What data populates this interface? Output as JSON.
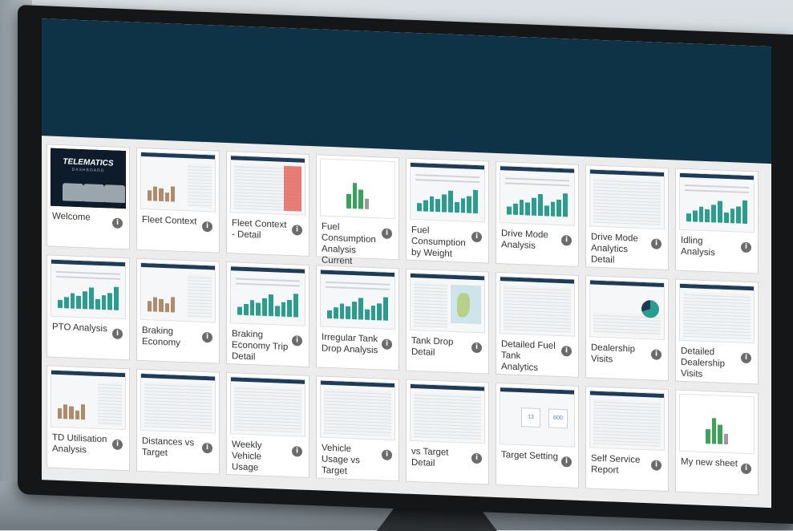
{
  "sheets": [
    {
      "title": "Welcome",
      "thumb": "logo"
    },
    {
      "title": "Fleet Context",
      "thumb": "dashboard"
    },
    {
      "title": "Fleet Context - Detail",
      "thumb": "table-red"
    },
    {
      "title": "Fuel Consumption Analysis Current",
      "thumb": "placeholder"
    },
    {
      "title": "Fuel Consumption by Weight",
      "thumb": "bars"
    },
    {
      "title": "Drive Mode Analysis",
      "thumb": "bars"
    },
    {
      "title": "Drive Mode Analytics Detail",
      "thumb": "table"
    },
    {
      "title": "Idling Analysis",
      "thumb": "bars"
    },
    {
      "title": "PTO Analysis",
      "thumb": "bars"
    },
    {
      "title": "Braking Economy",
      "thumb": "dashboard"
    },
    {
      "title": "Braking Economy Trip Detail",
      "thumb": "bars"
    },
    {
      "title": "Irregular Tank Drop Analysis",
      "thumb": "bars"
    },
    {
      "title": "Tank Drop Detail",
      "thumb": "map"
    },
    {
      "title": "Detailed Fuel Tank Analytics",
      "thumb": "table"
    },
    {
      "title": "Dealership Visits",
      "thumb": "pie"
    },
    {
      "title": "Detailed Dealership Visits",
      "thumb": "table"
    },
    {
      "title": "TD Utilisation Analysis",
      "thumb": "dashboard"
    },
    {
      "title": "Distances vs Target",
      "thumb": "table"
    },
    {
      "title": "Weekly Vehicle Usage",
      "thumb": "table"
    },
    {
      "title": "Vehicle Usage vs Target",
      "thumb": "table"
    },
    {
      "title": "vs Target Detail",
      "thumb": "table"
    },
    {
      "title": "Target Setting",
      "thumb": "kpi"
    },
    {
      "title": "Self Service Report",
      "thumb": "table"
    },
    {
      "title": "My new sheet",
      "thumb": "placeholder"
    }
  ],
  "welcome_logo": {
    "title": "TELEMATICS",
    "subtitle": "DASHBOARD"
  },
  "target_setting_kpis": [
    "13",
    "600"
  ],
  "info_glyph": "i",
  "icons": {
    "info": "info-icon"
  },
  "colors": {
    "header": "#0f3346",
    "accent_teal": "#2a9d8f",
    "placeholder_green": "#3aa35a",
    "placeholder_gray": "#9a9a9a"
  }
}
